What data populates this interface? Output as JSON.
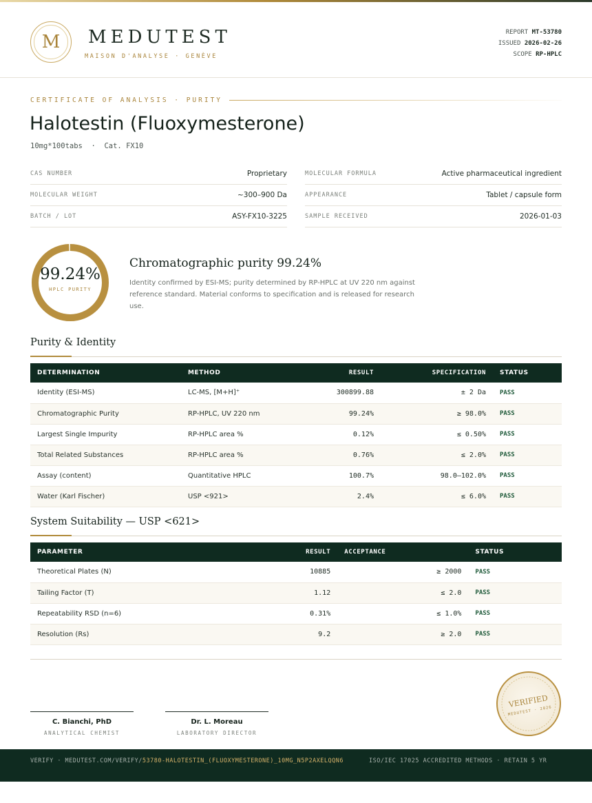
{
  "header": {
    "logo_letter": "M",
    "brand": "MEDUTEST",
    "brand_sub": "MAISON D'ANALYSE · GENÈVE",
    "report_label": "REPORT",
    "report_value": "MT-53780",
    "issued_label": "ISSUED",
    "issued_value": "2026-02-26",
    "scope_label": "SCOPE",
    "scope_value": "RP-HPLC"
  },
  "doc": {
    "kicker": "CERTIFICATE OF ANALYSIS · PURITY",
    "title": "Halotestin (Fluoxymesterone)",
    "subtitle": "10mg*100tabs  ·  Cat. FX10"
  },
  "info_left": [
    {
      "label": "CAS NUMBER",
      "value": "Proprietary"
    },
    {
      "label": "MOLECULAR WEIGHT",
      "value": "~300–900 Da"
    },
    {
      "label": "BATCH / LOT",
      "value": "ASY-FX10-3225"
    }
  ],
  "info_right": [
    {
      "label": "MOLECULAR FORMULA",
      "value": "Active pharmaceutical ingredient"
    },
    {
      "label": "APPEARANCE",
      "value": "Tablet / capsule form"
    },
    {
      "label": "SAMPLE RECEIVED",
      "value": "2026-01-03"
    }
  ],
  "purity": {
    "value_text": "99.24%",
    "fraction": 0.9924,
    "label": "HPLC PURITY",
    "summary_title": "Chromatographic purity 99.24%",
    "summary_text": "Identity confirmed by ESI-MS; purity determined by RP-HPLC at UV 220 nm against reference standard. Material conforms to specification and is released for research use."
  },
  "purity_section": {
    "heading": "Purity & Identity",
    "columns": [
      "DETERMINATION",
      "METHOD",
      "RESULT",
      "SPECIFICATION",
      "STATUS"
    ],
    "rows": [
      {
        "determination": "Identity (ESI-MS)",
        "method": "LC-MS, [M+H]⁺",
        "result": "300899.88",
        "spec": "± 2 Da",
        "status": "PASS"
      },
      {
        "determination": "Chromatographic Purity",
        "method": "RP-HPLC, UV 220 nm",
        "result": "99.24%",
        "spec": "≥ 98.0%",
        "status": "PASS"
      },
      {
        "determination": "Largest Single Impurity",
        "method": "RP-HPLC area %",
        "result": "0.12%",
        "spec": "≤ 0.50%",
        "status": "PASS"
      },
      {
        "determination": "Total Related Substances",
        "method": "RP-HPLC area %",
        "result": "0.76%",
        "spec": "≤ 2.0%",
        "status": "PASS"
      },
      {
        "determination": "Assay (content)",
        "method": "Quantitative HPLC",
        "result": "100.7%",
        "spec": "98.0–102.0%",
        "status": "PASS"
      },
      {
        "determination": "Water (Karl Fischer)",
        "method": "USP <921>",
        "result": "2.4%",
        "spec": "≤ 6.0%",
        "status": "PASS"
      }
    ]
  },
  "suitability_section": {
    "heading": "System Suitability — USP <621>",
    "columns": [
      "PARAMETER",
      "RESULT",
      "ACCEPTANCE",
      "STATUS"
    ],
    "rows": [
      {
        "parameter": "Theoretical Plates (N)",
        "result": "10885",
        "acceptance": "≥ 2000",
        "status": "PASS"
      },
      {
        "parameter": "Tailing Factor (T)",
        "result": "1.12",
        "acceptance": "≤ 2.0",
        "status": "PASS"
      },
      {
        "parameter": "Repeatability RSD (n=6)",
        "result": "0.31%",
        "acceptance": "≤ 1.0%",
        "status": "PASS"
      },
      {
        "parameter": "Resolution (Rs)",
        "result": "9.2",
        "acceptance": "≥ 2.0",
        "status": "PASS"
      }
    ]
  },
  "signatures": [
    {
      "name": "C. Bianchi, PhD",
      "role": "ANALYTICAL CHEMIST"
    },
    {
      "name": "Dr. L. Moreau",
      "role": "LABORATORY DIRECTOR"
    }
  ],
  "seal": {
    "main": "VERIFIED",
    "sub": "MEDUTEST · 2026"
  },
  "footer": {
    "verify_prefix": "VERIFY · MEDUTEST.COM/VERIFY/",
    "verify_code": "53780-HALOTESTIN_(FLUOXYMESTERONE)_10MG_N5P2AXELQQN6",
    "accreditation": "ISO/IEC 17025 ACCREDITED METHODS · RETAIN 5 YR"
  },
  "colors": {
    "accent_gold": "#b08a3a",
    "dark_green": "#0f2b20",
    "pass_green": "#1f5a3a"
  }
}
